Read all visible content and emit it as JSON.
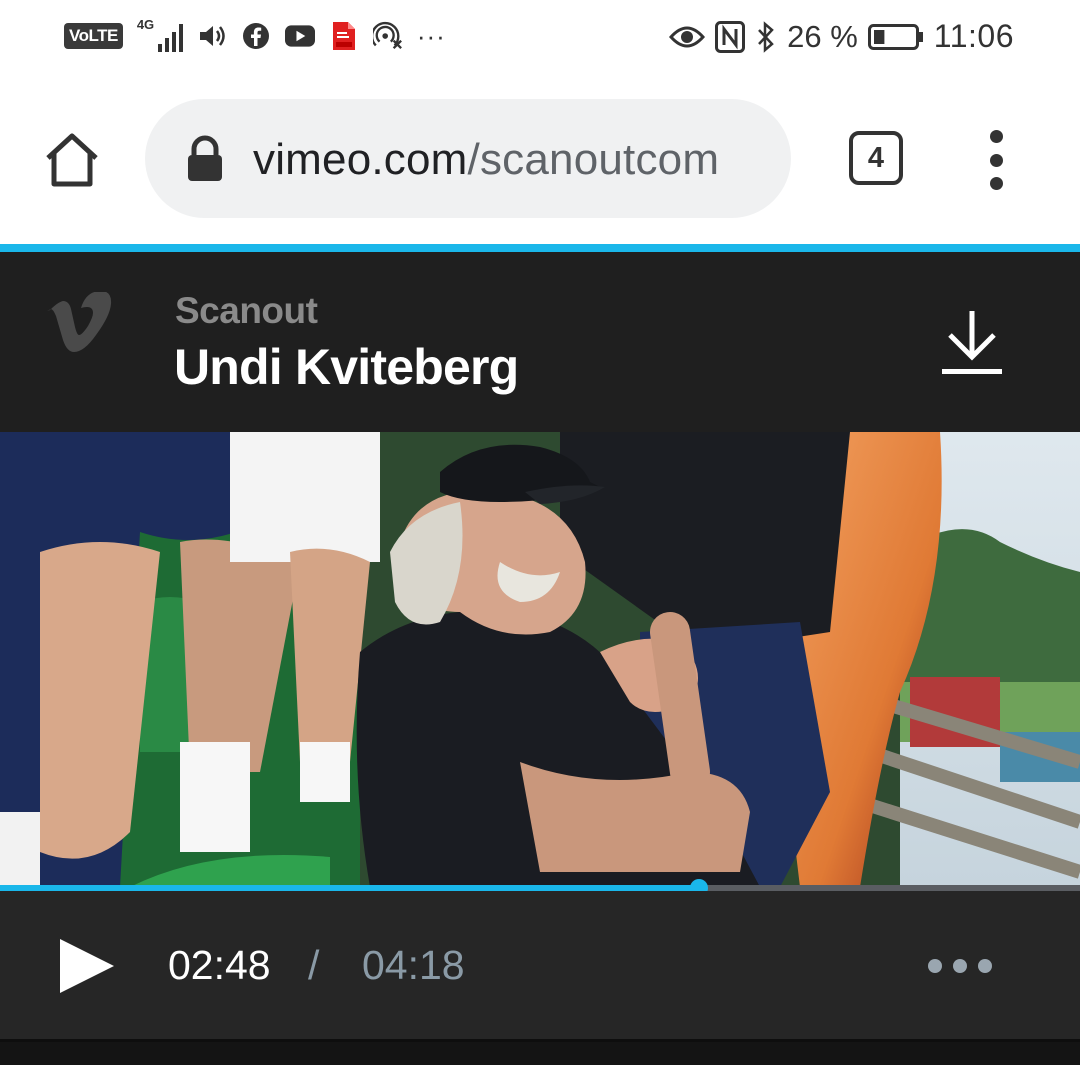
{
  "status_bar": {
    "volte": "VoLTE",
    "network": "4G",
    "battery_percent": "26 %",
    "battery_level": 0.26,
    "time": "11:06",
    "icons": [
      "volume-icon",
      "facebook-icon",
      "youtube-icon",
      "pdf-file-icon",
      "hotspot-icon",
      "more-notifications-icon",
      "eye-icon",
      "nfc-icon",
      "bluetooth-icon",
      "battery-icon"
    ],
    "more": "···"
  },
  "browser": {
    "url_domain": "vimeo.com",
    "url_path": "/scanoutcom",
    "tab_count": "4"
  },
  "player": {
    "channel": "Scanout",
    "title": "Undi Kviteberg",
    "current_time": "02:48",
    "separator": "/",
    "duration": "04:18",
    "progress_fraction": 0.647,
    "accent_color": "#1ab7ea"
  }
}
